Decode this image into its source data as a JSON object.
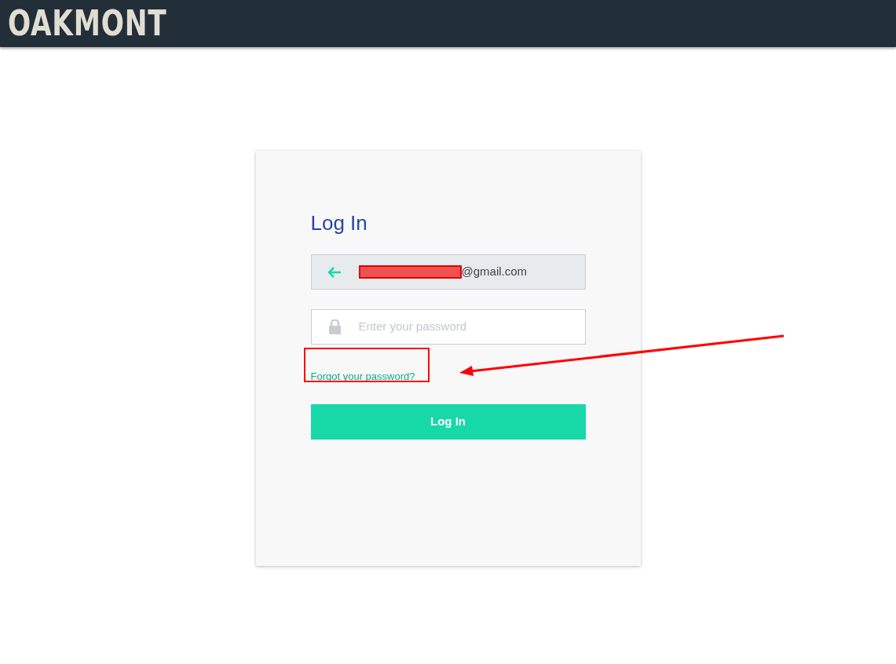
{
  "header": {
    "logo": "OAKMONT"
  },
  "login": {
    "title": "Log In",
    "email": {
      "value": "@gmail.com",
      "redacted": true
    },
    "password": {
      "placeholder": "Enter your password"
    },
    "forgot_link": "Forgot your password?",
    "submit": "Log In"
  },
  "annotation": {
    "highlight": true
  }
}
